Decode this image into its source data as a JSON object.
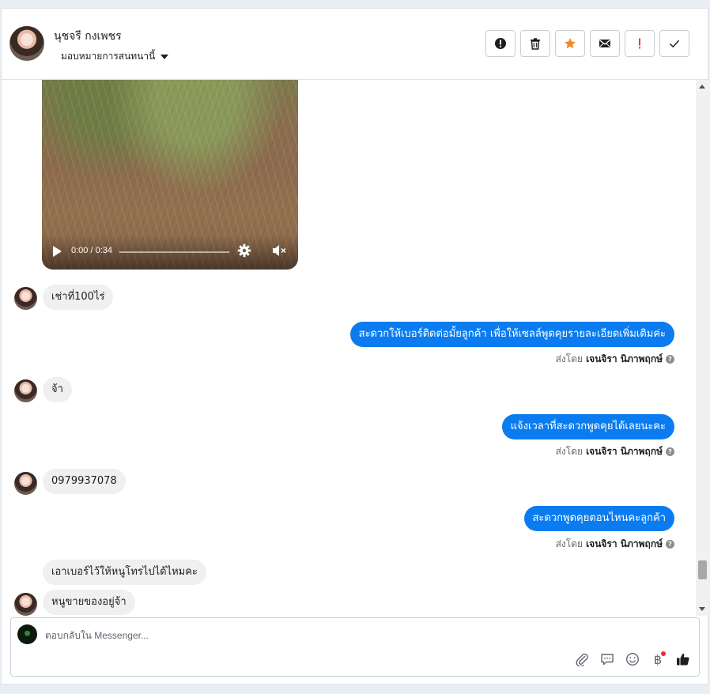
{
  "header": {
    "contact_name": "นุชจรี กงเพชร",
    "assign_label": "มอบหมายการสนทนานี้"
  },
  "actions": [
    {
      "name": "spam-button",
      "icon": "alert-circle-icon"
    },
    {
      "name": "delete-button",
      "icon": "trash-icon"
    },
    {
      "name": "star-button",
      "icon": "star-icon"
    },
    {
      "name": "mark-unread-button",
      "icon": "envelope-icon"
    },
    {
      "name": "follow-up-button",
      "icon": "exclamation-icon"
    },
    {
      "name": "done-button",
      "icon": "check-icon"
    }
  ],
  "video": {
    "time": "0:00 / 0:34",
    "progress": 0
  },
  "messages": {
    "in_1": "เช่าที่100ไร่",
    "out_1": "สะดวกให้เบอร์ติดต่อมั้ยลูกค้า เพื่อให้เซลล์พูดคุยรายละเอียดเพิ่มเติมค่ะ",
    "in_2": "จ้า",
    "out_2": "แจ้งเวลาที่สะดวกพูดคุยได้เลยนะคะ",
    "in_3": "0979937078",
    "out_3": "สะดวกพูดคุยตอนไหนคะลูกค้า",
    "in_4": "เอาเบอร์ไว้ให้หนูโทรไปได้ไหมคะ",
    "in_5": "หนูขายของอยู่จ้า"
  },
  "sent_by": {
    "prefix": "ส่งโดย",
    "agent": "เจนจิรา นิภาพฤกษ์"
  },
  "composer": {
    "placeholder": "ตอบกลับใน Messenger...",
    "currency_symbol": "฿"
  },
  "colors": {
    "outgoing_bubble": "#0b7cf0",
    "incoming_bubble": "#f0f0f0",
    "star": "#f08a24",
    "follow_up": "#e03e2d"
  }
}
